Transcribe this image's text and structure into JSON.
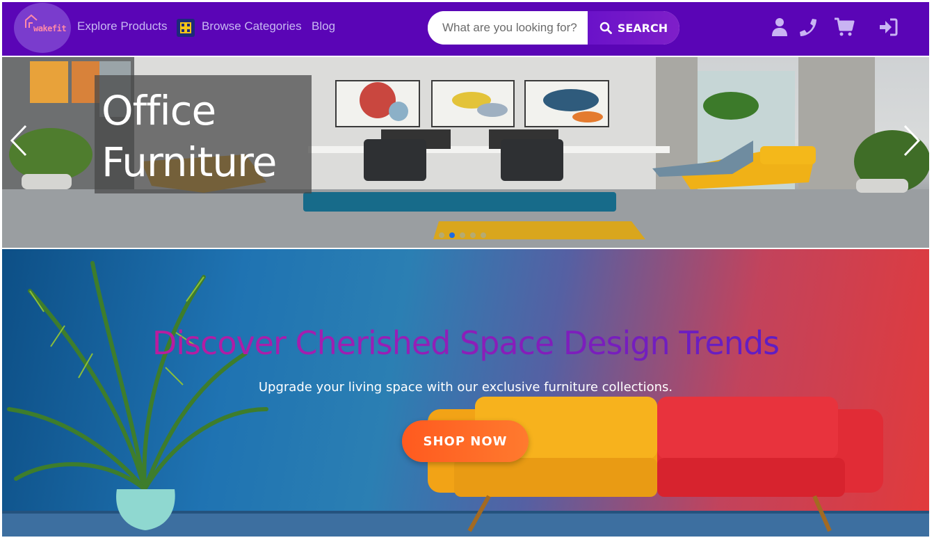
{
  "nav": {
    "logo_text": "wakefit",
    "explore_label": "Explore Products",
    "browse_label": "Browse Categories",
    "blog_label": "Blog",
    "search_placeholder": "What are you looking for?",
    "search_button_label": "SEARCH",
    "icons": [
      "user-icon",
      "phone-icon",
      "cart-icon",
      "login-icon"
    ]
  },
  "carousel": {
    "slide_title": "Office Furniture",
    "slide_count": 5,
    "active_slide": 2
  },
  "promo": {
    "heading": "Discover Cherished Space Design Trends",
    "subheading": "Upgrade your living space with our exclusive furniture collections.",
    "cta_label": "SHOP NOW"
  },
  "colors": {
    "navbar": "#5a05b6",
    "search_button": "#6a12c9",
    "cta": "#ff5a1f",
    "heading_gradient_start": "#d21a8e",
    "heading_gradient_end": "#4a1dc8"
  }
}
